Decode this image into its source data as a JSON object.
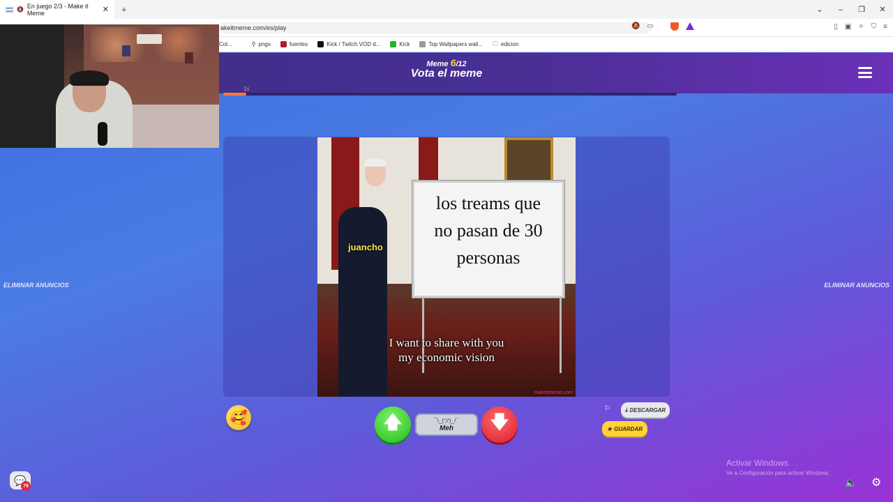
{
  "browser": {
    "tab_title": "En juego 2/3 - Make it Meme",
    "tab_close": "✕",
    "new_tab": "+",
    "url": "akeitmeme.com/es/play",
    "window_controls": [
      "⌄",
      "–",
      "❐",
      "✕"
    ],
    "bookmarks": [
      {
        "label": "Col...",
        "color": "#888888"
      },
      {
        "label": "pngs",
        "color": "#5a6a8a"
      },
      {
        "label": "fuentes",
        "color": "#b01e2a"
      },
      {
        "label": "Kick / Twitch VOD d...",
        "color": "#111111"
      },
      {
        "label": "Kick",
        "color": "#27b02a"
      },
      {
        "label": "Top Wallpapers wall...",
        "color": "#777777"
      },
      {
        "label": "edicion",
        "color": "#555555"
      }
    ]
  },
  "header": {
    "counter_prefix": "Meme",
    "counter_current": "6",
    "counter_total": "/12",
    "title": "Vota el meme",
    "timer_label": "1s",
    "timer_progress": 0.05
  },
  "ads": {
    "left": "ELIMINAR ANUNCIOS",
    "right": "ELIMINAR ANUNCIOS"
  },
  "meme": {
    "board_lines": [
      "los treams que",
      "no pasan de 30",
      "personas"
    ],
    "label": "juancho",
    "caption_lines": [
      "I want to share with you",
      "my economic vision"
    ],
    "watermark": "makeitmeme.com"
  },
  "vote": {
    "up_icon": "arrow-up-icon",
    "meh_face": "¯\\_(ツ)_/¯",
    "meh_label": "Meh",
    "down_icon": "arrow-down-icon"
  },
  "actions": {
    "report_icon": "flag-icon",
    "download_label": "DESCARGAR",
    "save_label": "GUARDAR"
  },
  "chat": {
    "badge_count": "79"
  },
  "windows_notice": {
    "line1": "Activar Windows",
    "line2": "Ve a Configuración para activar Windows."
  },
  "colors": {
    "upvote": "#22b81c",
    "downvote": "#d91b2e",
    "save": "#ffd23a",
    "timer": "#ff7a3d"
  }
}
